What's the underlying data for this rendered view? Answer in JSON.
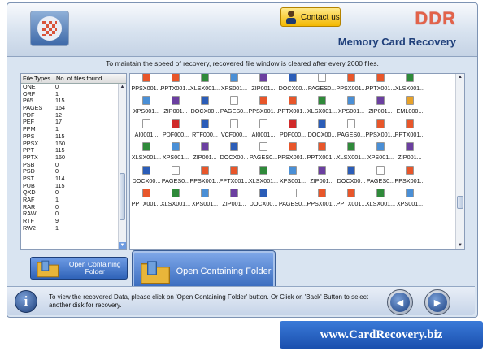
{
  "header": {
    "contact_label": "Contact us",
    "brand": "DDR",
    "product": "Memory Card Recovery"
  },
  "info_line": "To maintain the speed of recovery, recovered file window is cleared after every 2000 files.",
  "file_types": {
    "columns": [
      "File Types",
      "No. of files found"
    ],
    "rows": [
      [
        "ONE",
        "0"
      ],
      [
        "ORF",
        "1"
      ],
      [
        "P65",
        "115"
      ],
      [
        "PAGES",
        "164"
      ],
      [
        "PDF",
        "12"
      ],
      [
        "PEF",
        "17"
      ],
      [
        "PPM",
        "1"
      ],
      [
        "PPS",
        "115"
      ],
      [
        "PPSX",
        "160"
      ],
      [
        "PPT",
        "115"
      ],
      [
        "PPTX",
        "160"
      ],
      [
        "PSB",
        "0"
      ],
      [
        "PSD",
        "0"
      ],
      [
        "PST",
        "114"
      ],
      [
        "PUB",
        "115"
      ],
      [
        "QXD",
        "0"
      ],
      [
        "RAF",
        "1"
      ],
      [
        "RAR",
        "0"
      ],
      [
        "RAW",
        "0"
      ],
      [
        "RTF",
        "9"
      ],
      [
        "RW2",
        "1"
      ],
      [
        "",
        ""
      ]
    ]
  },
  "files": {
    "rows": [
      [
        "PPSX001...",
        "PPTX001...",
        "XLSX001...",
        "XPS001...",
        "ZIP001...",
        "DOCX00...",
        "PAGES0...",
        "PPSX001...",
        "PPTX001...",
        "XLSX001..."
      ],
      [
        "XPS001...",
        "ZIP001...",
        "DOCX00...",
        "PAGES0...",
        "PPSX001...",
        "PPTX001...",
        "XLSX001...",
        "XPS001...",
        "ZIP001...",
        "EML000..."
      ],
      [
        "AI0001...",
        "PDF000...",
        "RTF000...",
        "VCF000...",
        "AI0001...",
        "PDF000...",
        "DOCX00...",
        "PAGES0...",
        "PPSX001...",
        "PPTX001..."
      ],
      [
        "XLSX001...",
        "XPS001...",
        "ZIP001...",
        "DOCX00...",
        "PAGES0...",
        "PPSX001...",
        "PPTX001...",
        "XLSX001...",
        "XPS001...",
        "ZIP001..."
      ],
      [
        "DOCX00...",
        "PAGES0...",
        "PPSX001...",
        "PPTX001...",
        "XLSX001...",
        "XPS001...",
        "ZIP001...",
        "DOCX00...",
        "PAGES0...",
        "PPSX001..."
      ],
      [
        "PPTX001...",
        "XLSX001...",
        "XPS001...",
        "ZIP001...",
        "DOCX00...",
        "PAGES0...",
        "PPSX001...",
        "PPTX001...",
        "XLSX001...",
        "XPS001..."
      ]
    ],
    "icon_colors": {
      "PPSX": "#e8562a",
      "PPTX": "#e8562a",
      "XLSX": "#2f8a3a",
      "XPS": "#4a8fd6",
      "ZIP": "#6b3fa0",
      "DOCX": "#2b5db8",
      "PAGES": "#ffffff",
      "EML": "#e8a22a",
      "AI": "#ffffff",
      "PDF": "#d02a2a",
      "RTF": "#2b5db8",
      "VCF": "#ffffff"
    }
  },
  "buttons": {
    "open_folder_small": "Open Containing Folder",
    "open_folder_big": "Open Containing Folder"
  },
  "footer": {
    "help_text": "To view the recovered Data, please click on 'Open Containing Folder' button. Or Click on 'Back' Button to select another disk for recovery."
  },
  "banner": "www.CardRecovery.biz"
}
